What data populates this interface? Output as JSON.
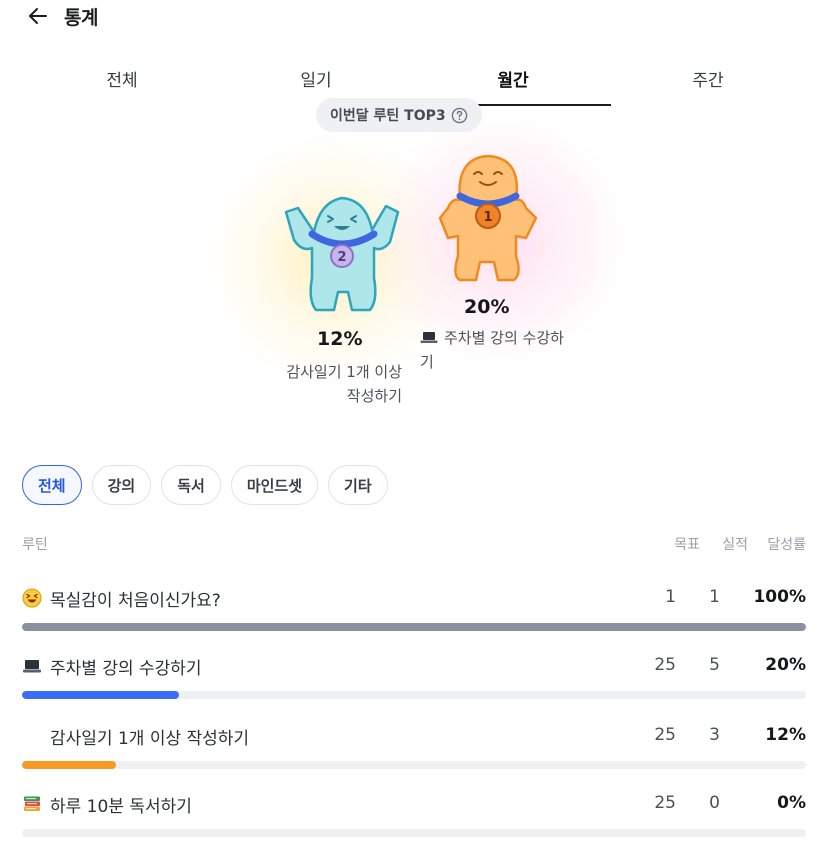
{
  "header": {
    "title": "통계",
    "back_icon": "arrow-left-icon"
  },
  "tabs": [
    {
      "label": "전체",
      "active": false
    },
    {
      "label": "일기",
      "active": false
    },
    {
      "label": "월간",
      "active": true
    },
    {
      "label": "주간",
      "active": false
    }
  ],
  "top3": {
    "label": "이번달 루틴 TOP3",
    "help_icon": "question-circle-icon",
    "ranks": [
      {
        "rank": "1",
        "percent": "20%",
        "icon": "laptop-icon",
        "name": "주차별 강의 수강하기",
        "badge_color": "#f0822a"
      },
      {
        "rank": "2",
        "percent": "12%",
        "name": "감사일기 1개 이상 작성하기",
        "badge_color": "#b89ee0"
      }
    ]
  },
  "chips": [
    {
      "label": "전체",
      "active": true
    },
    {
      "label": "강의",
      "active": false
    },
    {
      "label": "독서",
      "active": false
    },
    {
      "label": "마인드셋",
      "active": false
    },
    {
      "label": "기타",
      "active": false
    }
  ],
  "table": {
    "headers": {
      "routine": "루틴",
      "goal": "목표",
      "actual": "실적",
      "rate": "달성률"
    },
    "rows": [
      {
        "icon": "laughing-face-icon",
        "name": "목실감이 처음이신가요?",
        "goal": "1",
        "actual": "1",
        "rate": "100%",
        "progress": 1.0,
        "bar_color": "#8b919c"
      },
      {
        "icon": "laptop-icon",
        "name": "주차별 강의 수강하기",
        "goal": "25",
        "actual": "5",
        "rate": "20%",
        "progress": 0.2,
        "bar_color": "#3b6cf6"
      },
      {
        "icon": "",
        "name": "감사일기 1개 이상 작성하기",
        "goal": "25",
        "actual": "3",
        "rate": "12%",
        "progress": 0.12,
        "bar_color": "#f59a23"
      },
      {
        "icon": "books-icon",
        "name": "하루 10분 독서하기",
        "goal": "25",
        "actual": "0",
        "rate": "0%",
        "progress": 0.0,
        "bar_color": "#3b6cf6"
      }
    ]
  }
}
